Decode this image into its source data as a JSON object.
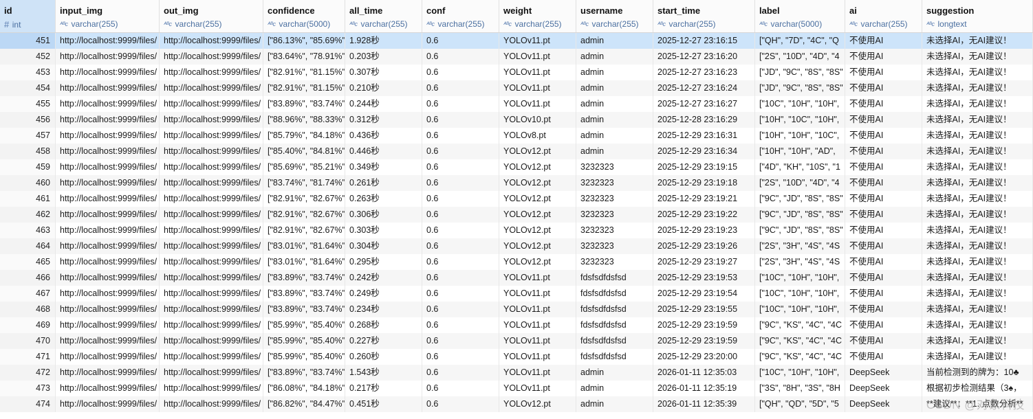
{
  "columns": [
    {
      "name": "id",
      "type": "int",
      "icon": "hash-icon"
    },
    {
      "name": "input_img",
      "type": "varchar(255)",
      "icon": "text-type-icon"
    },
    {
      "name": "out_img",
      "type": "varchar(255)",
      "icon": "text-type-icon"
    },
    {
      "name": "confidence",
      "type": "varchar(5000)",
      "icon": "text-type-icon"
    },
    {
      "name": "all_time",
      "type": "varchar(255)",
      "icon": "text-type-icon"
    },
    {
      "name": "conf",
      "type": "varchar(255)",
      "icon": "text-type-icon"
    },
    {
      "name": "weight",
      "type": "varchar(255)",
      "icon": "text-type-icon"
    },
    {
      "name": "username",
      "type": "varchar(255)",
      "icon": "text-type-icon"
    },
    {
      "name": "start_time",
      "type": "varchar(255)",
      "icon": "text-type-icon"
    },
    {
      "name": "label",
      "type": "varchar(5000)",
      "icon": "text-type-icon"
    },
    {
      "name": "ai",
      "type": "varchar(255)",
      "icon": "text-type-icon"
    },
    {
      "name": "suggestion",
      "type": "longtext",
      "icon": "text-type-icon"
    }
  ],
  "type_icon_glyph": "ᴬᴮc",
  "hash_icon_glyph": "#",
  "rows": [
    [
      "451",
      "http://localhost:9999/files/",
      "http://localhost:9999/files/",
      "[\"86.13%\", \"85.69%\"",
      "1.928秒",
      "0.6",
      "YOLOv11.pt",
      "admin",
      "2025-12-27 23:16:15",
      "[\"QH\", \"7D\", \"4C\", \"Q",
      "不使用AI",
      "未选择AI，无AI建议！"
    ],
    [
      "452",
      "http://localhost:9999/files/",
      "http://localhost:9999/files/",
      "[\"83.64%\", \"78.91%\"",
      "0.203秒",
      "0.6",
      "YOLOv11.pt",
      "admin",
      "2025-12-27 23:16:20",
      "[\"2S\", \"10D\", \"4D\", \"4",
      "不使用AI",
      "未选择AI，无AI建议！"
    ],
    [
      "453",
      "http://localhost:9999/files/",
      "http://localhost:9999/files/",
      "[\"82.91%\", \"81.15%\"",
      "0.307秒",
      "0.6",
      "YOLOv11.pt",
      "admin",
      "2025-12-27 23:16:23",
      "[\"JD\", \"9C\", \"8S\", \"8S\"",
      "不使用AI",
      "未选择AI，无AI建议！"
    ],
    [
      "454",
      "http://localhost:9999/files/",
      "http://localhost:9999/files/",
      "[\"82.91%\", \"81.15%\"",
      "0.210秒",
      "0.6",
      "YOLOv11.pt",
      "admin",
      "2025-12-27 23:16:24",
      "[\"JD\", \"9C\", \"8S\", \"8S\"",
      "不使用AI",
      "未选择AI，无AI建议！"
    ],
    [
      "455",
      "http://localhost:9999/files/",
      "http://localhost:9999/files/",
      "[\"83.89%\", \"83.74%\"",
      "0.244秒",
      "0.6",
      "YOLOv11.pt",
      "admin",
      "2025-12-27 23:16:27",
      "[\"10C\", \"10H\", \"10H\",",
      "不使用AI",
      "未选择AI，无AI建议！"
    ],
    [
      "456",
      "http://localhost:9999/files/",
      "http://localhost:9999/files/",
      "[\"88.96%\", \"88.33%\"",
      "0.312秒",
      "0.6",
      "YOLOv10.pt",
      "admin",
      "2025-12-28 23:16:29",
      "[\"10H\", \"10C\", \"10H\",",
      "不使用AI",
      "未选择AI，无AI建议！"
    ],
    [
      "457",
      "http://localhost:9999/files/",
      "http://localhost:9999/files/",
      "[\"85.79%\", \"84.18%\"",
      "0.436秒",
      "0.6",
      "YOLOv8.pt",
      "admin",
      "2025-12-29 23:16:31",
      "[\"10H\", \"10H\", \"10C\",",
      "不使用AI",
      "未选择AI，无AI建议！"
    ],
    [
      "458",
      "http://localhost:9999/files/",
      "http://localhost:9999/files/",
      "[\"85.40%\", \"84.81%\"",
      "0.446秒",
      "0.6",
      "YOLOv12.pt",
      "admin",
      "2025-12-29 23:16:34",
      "[\"10H\", \"10H\", \"AD\",",
      "不使用AI",
      "未选择AI，无AI建议！"
    ],
    [
      "459",
      "http://localhost:9999/files/",
      "http://localhost:9999/files/",
      "[\"85.69%\", \"85.21%\"",
      "0.349秒",
      "0.6",
      "YOLOv12.pt",
      "3232323",
      "2025-12-29 23:19:15",
      "[\"4D\", \"KH\", \"10S\", \"1",
      "不使用AI",
      "未选择AI，无AI建议！"
    ],
    [
      "460",
      "http://localhost:9999/files/",
      "http://localhost:9999/files/",
      "[\"83.74%\", \"81.74%\"",
      "0.261秒",
      "0.6",
      "YOLOv12.pt",
      "3232323",
      "2025-12-29 23:19:18",
      "[\"2S\", \"10D\", \"4D\", \"4",
      "不使用AI",
      "未选择AI，无AI建议！"
    ],
    [
      "461",
      "http://localhost:9999/files/",
      "http://localhost:9999/files/",
      "[\"82.91%\", \"82.67%\"",
      "0.263秒",
      "0.6",
      "YOLOv12.pt",
      "3232323",
      "2025-12-29 23:19:21",
      "[\"9C\", \"JD\", \"8S\", \"8S\"",
      "不使用AI",
      "未选择AI，无AI建议！"
    ],
    [
      "462",
      "http://localhost:9999/files/",
      "http://localhost:9999/files/",
      "[\"82.91%\", \"82.67%\"",
      "0.306秒",
      "0.6",
      "YOLOv12.pt",
      "3232323",
      "2025-12-29 23:19:22",
      "[\"9C\", \"JD\", \"8S\", \"8S\"",
      "不使用AI",
      "未选择AI，无AI建议！"
    ],
    [
      "463",
      "http://localhost:9999/files/",
      "http://localhost:9999/files/",
      "[\"82.91%\", \"82.67%\"",
      "0.303秒",
      "0.6",
      "YOLOv12.pt",
      "3232323",
      "2025-12-29 23:19:23",
      "[\"9C\", \"JD\", \"8S\", \"8S\"",
      "不使用AI",
      "未选择AI，无AI建议！"
    ],
    [
      "464",
      "http://localhost:9999/files/",
      "http://localhost:9999/files/",
      "[\"83.01%\", \"81.64%\"",
      "0.304秒",
      "0.6",
      "YOLOv12.pt",
      "3232323",
      "2025-12-29 23:19:26",
      "[\"2S\", \"3H\", \"4S\", \"4S",
      "不使用AI",
      "未选择AI，无AI建议！"
    ],
    [
      "465",
      "http://localhost:9999/files/",
      "http://localhost:9999/files/",
      "[\"83.01%\", \"81.64%\"",
      "0.295秒",
      "0.6",
      "YOLOv12.pt",
      "3232323",
      "2025-12-29 23:19:27",
      "[\"2S\", \"3H\", \"4S\", \"4S",
      "不使用AI",
      "未选择AI，无AI建议！"
    ],
    [
      "466",
      "http://localhost:9999/files/",
      "http://localhost:9999/files/",
      "[\"83.89%\", \"83.74%\"",
      "0.242秒",
      "0.6",
      "YOLOv11.pt",
      "fdsfsdfdsfsd",
      "2025-12-29 23:19:53",
      "[\"10C\", \"10H\", \"10H\",",
      "不使用AI",
      "未选择AI，无AI建议！"
    ],
    [
      "467",
      "http://localhost:9999/files/",
      "http://localhost:9999/files/",
      "[\"83.89%\", \"83.74%\"",
      "0.249秒",
      "0.6",
      "YOLOv11.pt",
      "fdsfsdfdsfsd",
      "2025-12-29 23:19:54",
      "[\"10C\", \"10H\", \"10H\",",
      "不使用AI",
      "未选择AI，无AI建议！"
    ],
    [
      "468",
      "http://localhost:9999/files/",
      "http://localhost:9999/files/",
      "[\"83.89%\", \"83.74%\"",
      "0.234秒",
      "0.6",
      "YOLOv11.pt",
      "fdsfsdfdsfsd",
      "2025-12-29 23:19:55",
      "[\"10C\", \"10H\", \"10H\",",
      "不使用AI",
      "未选择AI，无AI建议！"
    ],
    [
      "469",
      "http://localhost:9999/files/",
      "http://localhost:9999/files/",
      "[\"85.99%\", \"85.40%\"",
      "0.268秒",
      "0.6",
      "YOLOv11.pt",
      "fdsfsdfdsfsd",
      "2025-12-29 23:19:59",
      "[\"9C\", \"KS\", \"4C\", \"4C",
      "不使用AI",
      "未选择AI，无AI建议！"
    ],
    [
      "470",
      "http://localhost:9999/files/",
      "http://localhost:9999/files/",
      "[\"85.99%\", \"85.40%\"",
      "0.227秒",
      "0.6",
      "YOLOv11.pt",
      "fdsfsdfdsfsd",
      "2025-12-29 23:19:59",
      "[\"9C\", \"KS\", \"4C\", \"4C",
      "不使用AI",
      "未选择AI，无AI建议！"
    ],
    [
      "471",
      "http://localhost:9999/files/",
      "http://localhost:9999/files/",
      "[\"85.99%\", \"85.40%\"",
      "0.260秒",
      "0.6",
      "YOLOv11.pt",
      "fdsfsdfdsfsd",
      "2025-12-29 23:20:00",
      "[\"9C\", \"KS\", \"4C\", \"4C",
      "不使用AI",
      "未选择AI，无AI建议！"
    ],
    [
      "472",
      "http://localhost:9999/files/",
      "http://localhost:9999/files/",
      "[\"83.89%\", \"83.74%\"",
      "1.543秒",
      "0.6",
      "YOLOv11.pt",
      "admin",
      "2026-01-11 12:35:03",
      "[\"10C\", \"10H\", \"10H\",",
      "DeepSeek",
      "当前检测到的牌为：10♣"
    ],
    [
      "473",
      "http://localhost:9999/files/",
      "http://localhost:9999/files/",
      "[\"86.08%\", \"84.18%\"",
      "0.217秒",
      "0.6",
      "YOLOv11.pt",
      "admin",
      "2026-01-11 12:35:19",
      "[\"3S\", \"8H\", \"3S\", \"8H",
      "DeepSeek",
      "根据初步检测结果（3♠，"
    ],
    [
      "474",
      "http://localhost:9999/files/",
      "http://localhost:9999/files/",
      "[\"86.82%\", \"84.47%\"",
      "0.451秒",
      "0.6",
      "YOLOv12.pt",
      "admin",
      "2026-01-11 12:35:39",
      "[\"QH\", \"QD\", \"5D\", \"5",
      "DeepSeek",
      "**建议**：**1. 点数分析**"
    ]
  ],
  "watermark": "CSDN @对象科技",
  "colors": {
    "selected_row": "#cde4fa",
    "header_bg": "#fbfbfb",
    "type_text": "#4a6fa0"
  }
}
